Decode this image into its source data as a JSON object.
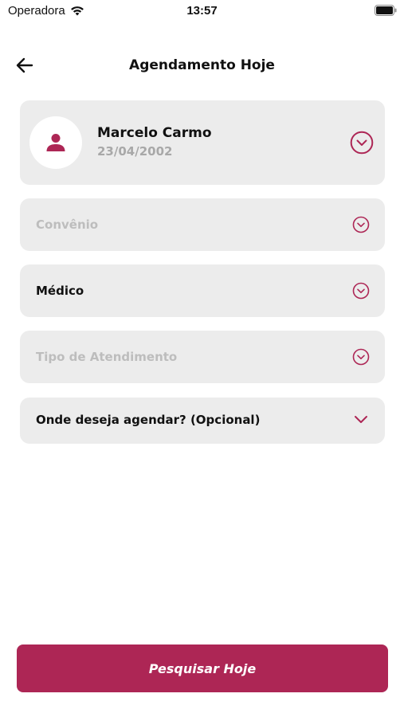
{
  "status_bar": {
    "carrier": "Operadora",
    "time": "13:57"
  },
  "header": {
    "title": "Agendamento Hoje",
    "back_icon": "arrow-left-icon"
  },
  "profile": {
    "name": "Marcelo Carmo",
    "birthdate": "23/04/2002",
    "avatar_icon": "user-icon"
  },
  "fields": [
    {
      "label": "Convênio",
      "state": "placeholder"
    },
    {
      "label": "Médico",
      "state": "filled"
    },
    {
      "label": "Tipo de Atendimento",
      "state": "placeholder"
    },
    {
      "label": "Onde deseja agendar? (Opcional)",
      "state": "filled"
    }
  ],
  "action": {
    "search_label": "Pesquisar Hoje"
  },
  "colors": {
    "accent": "#ad2655",
    "card_bg": "#ececec",
    "placeholder": "#bdbdbd"
  }
}
